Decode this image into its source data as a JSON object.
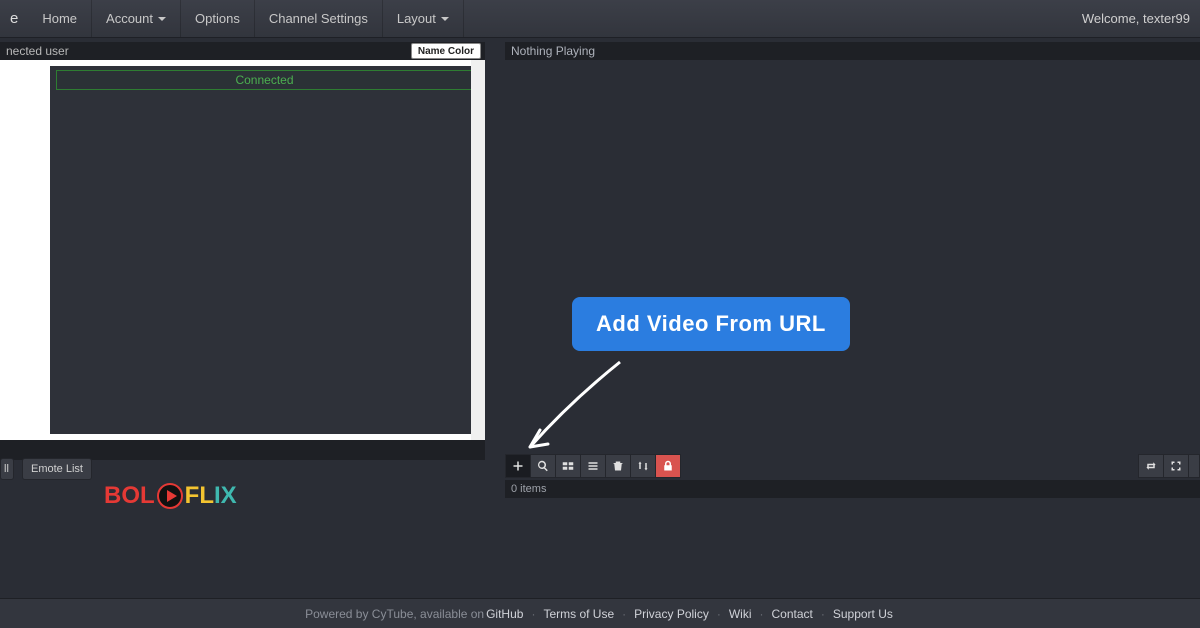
{
  "navbar": {
    "brand_fragment": "e",
    "items": [
      {
        "label": "Home",
        "dropdown": false
      },
      {
        "label": "Account",
        "dropdown": true
      },
      {
        "label": "Options",
        "dropdown": false
      },
      {
        "label": "Channel Settings",
        "dropdown": false
      },
      {
        "label": "Layout",
        "dropdown": true
      }
    ],
    "welcome": "Welcome, texter99"
  },
  "chat": {
    "header": "nected user",
    "name_color_btn": "Name Color",
    "connected": "Connected"
  },
  "buttons": {
    "poll_fragment": "ll",
    "emote_list": "Emote List"
  },
  "video": {
    "now_playing": "Nothing Playing"
  },
  "playlist": {
    "count_label": "0 items"
  },
  "callout": {
    "label": "Add Video From URL"
  },
  "footer": {
    "prefix": "Powered by CyTube, available on ",
    "links": [
      "GitHub",
      "Terms of Use",
      "Privacy Policy",
      "Wiki",
      "Contact",
      "Support Us"
    ]
  },
  "logo": {
    "part1": "BOL",
    "part2": "FL",
    "part3": "IX"
  }
}
